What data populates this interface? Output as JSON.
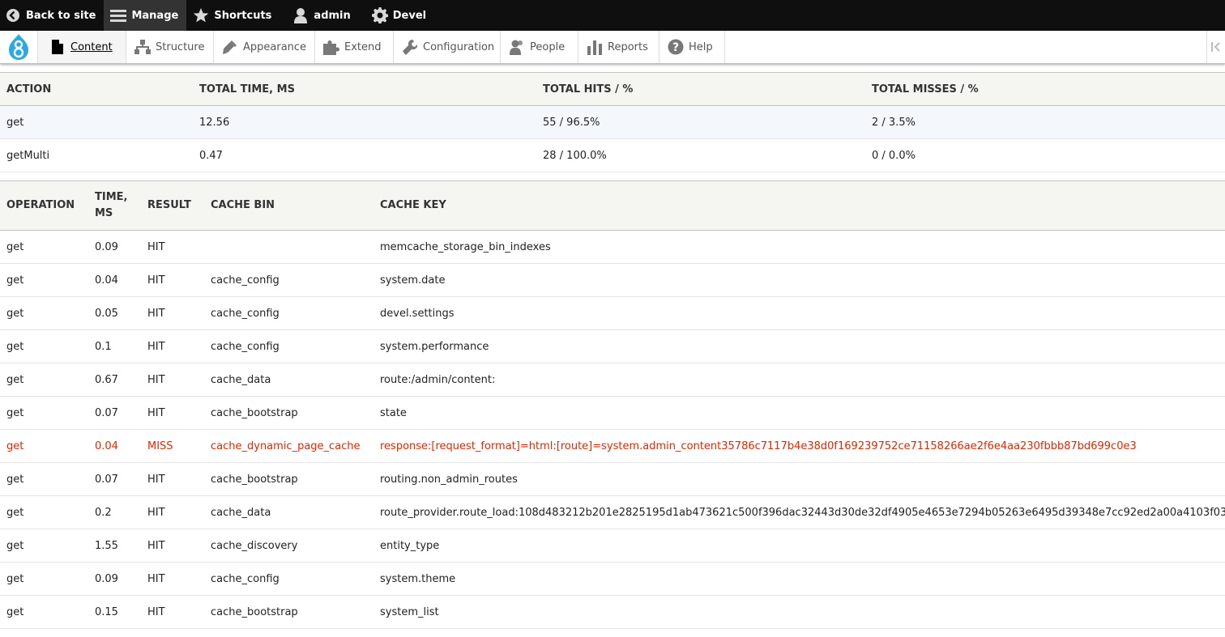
{
  "toolbar": {
    "back": "Back to site",
    "manage": "Manage",
    "shortcuts": "Shortcuts",
    "user": "admin",
    "devel": "Devel"
  },
  "tray": {
    "items": [
      {
        "label": "Content",
        "icon": "content-icon"
      },
      {
        "label": "Structure",
        "icon": "structure-icon"
      },
      {
        "label": "Appearance",
        "icon": "appearance-icon"
      },
      {
        "label": "Extend",
        "icon": "extend-icon"
      },
      {
        "label": "Configuration",
        "icon": "configuration-icon"
      },
      {
        "label": "People",
        "icon": "people-icon"
      },
      {
        "label": "Reports",
        "icon": "reports-icon"
      },
      {
        "label": "Help",
        "icon": "help-icon"
      }
    ]
  },
  "summary": {
    "headers": [
      "ACTION",
      "TOTAL TIME, MS",
      "TOTAL HITS / %",
      "TOTAL MISSES / %"
    ],
    "rows": [
      [
        "get",
        "12.56",
        "55 / 96.5%",
        "2 / 3.5%"
      ],
      [
        "getMulti",
        "0.47",
        "28 / 100.0%",
        "0 / 0.0%"
      ]
    ]
  },
  "operations": {
    "headers": [
      "OPERATION",
      "TIME, MS",
      "RESULT",
      "CACHE BIN",
      "CACHE KEY"
    ],
    "rows": [
      [
        "get",
        "0.09",
        "HIT",
        "",
        "memcache_storage_bin_indexes"
      ],
      [
        "get",
        "0.04",
        "HIT",
        "cache_config",
        "system.date"
      ],
      [
        "get",
        "0.05",
        "HIT",
        "cache_config",
        "devel.settings"
      ],
      [
        "get",
        "0.1",
        "HIT",
        "cache_config",
        "system.performance"
      ],
      [
        "get",
        "0.67",
        "HIT",
        "cache_data",
        "route:/admin/content:"
      ],
      [
        "get",
        "0.07",
        "HIT",
        "cache_bootstrap",
        "state"
      ],
      [
        "get",
        "0.04",
        "MISS",
        "cache_dynamic_page_cache",
        "response:[request_format]=html:[route]=system.admin_content35786c7117b4e38d0f169239752ce71158266ae2f6e4aa230fbbb87bd699c0e3"
      ],
      [
        "get",
        "0.07",
        "HIT",
        "cache_bootstrap",
        "routing.non_admin_routes"
      ],
      [
        "get",
        "0.2",
        "HIT",
        "cache_data",
        "route_provider.route_load:108d483212b201e2825195d1ab473621c500f396dac32443d30de32df4905e4653e7294b05263e6495d39348e7cc92ed2a00a4103f03"
      ],
      [
        "get",
        "1.55",
        "HIT",
        "cache_discovery",
        "entity_type"
      ],
      [
        "get",
        "0.09",
        "HIT",
        "cache_config",
        "system.theme"
      ],
      [
        "get",
        "0.15",
        "HIT",
        "cache_bootstrap",
        "system_list"
      ]
    ]
  },
  "colors": {
    "toolbar_bg": "#0f0f0f",
    "miss_text": "#e32700",
    "header_bg": "#f5f5f2",
    "logo_blue": "#2ba9e0"
  }
}
